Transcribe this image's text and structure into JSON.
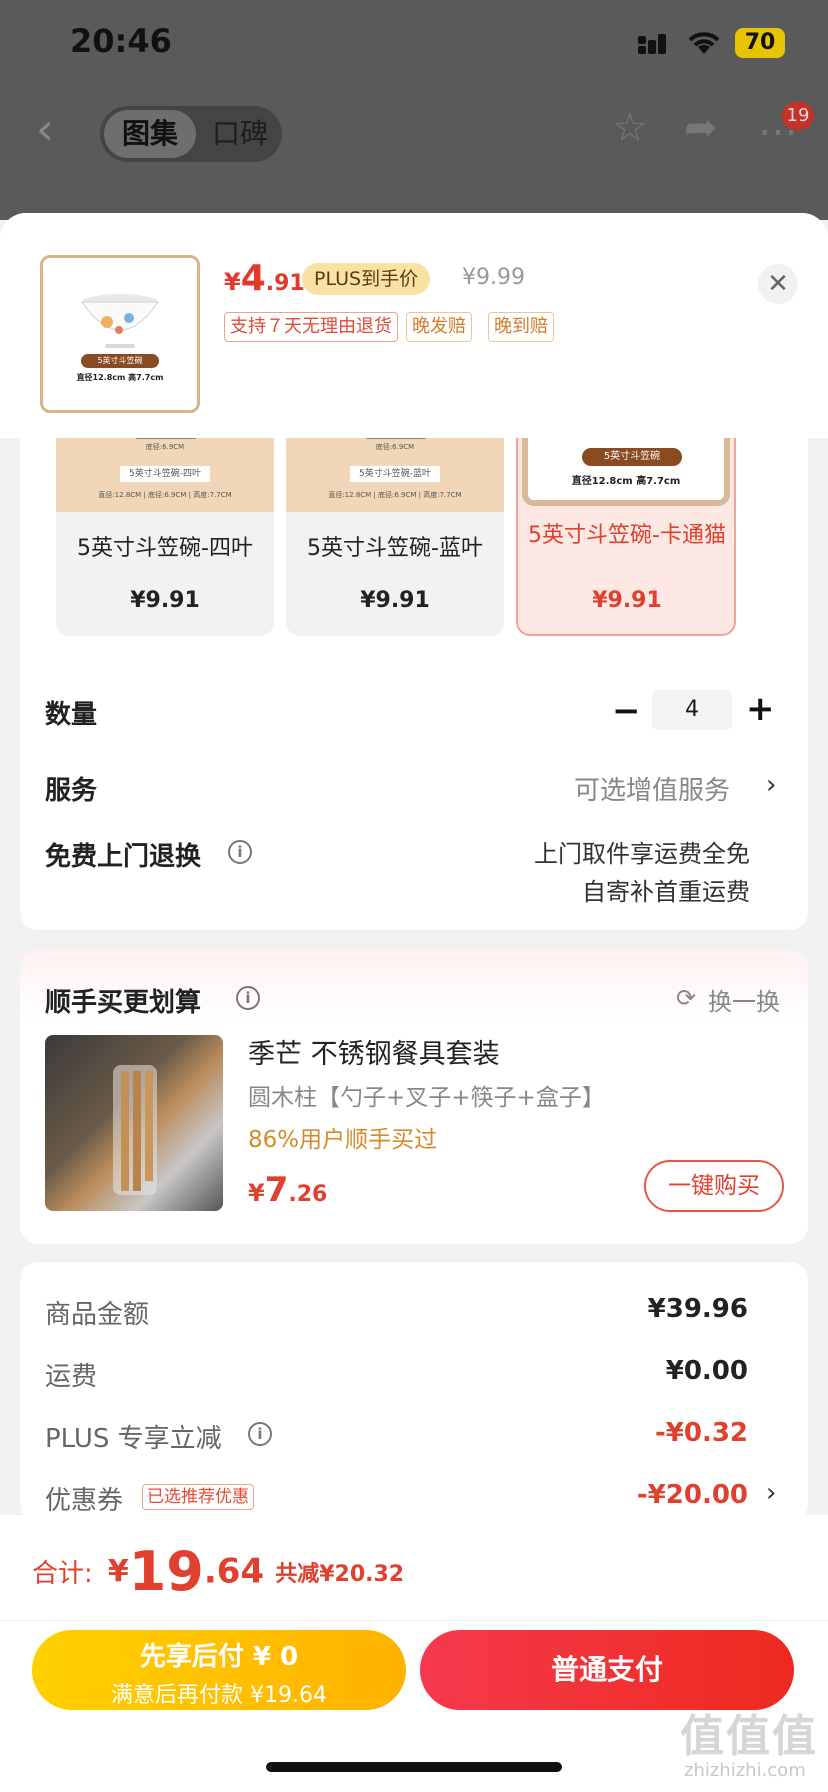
{
  "status_bar": {
    "time": "20:46",
    "battery": "70"
  },
  "nav": {
    "tab_gallery": "图集",
    "tab_reviews": "口碑",
    "badge": "19"
  },
  "header": {
    "price_symbol": "¥",
    "price_int": "4",
    "price_dec": ".91",
    "plus_label": "PLUS到手价",
    "original_price": "¥9.99",
    "tags": [
      "支持７天无理由退货",
      "晚发赔",
      "晚到赔"
    ],
    "thumb_label": "5英寸斗笠碗",
    "thumb_dims": "直径12.8cm  高7.7cm"
  },
  "options": [
    {
      "name": "5英寸斗笠碗-四叶",
      "price": "¥9.91",
      "img_label": "5英寸斗笠碗-四叶",
      "img_dims": "直径:12.8CM | 底径:6.9CM | 高度:7.7CM",
      "img_top": "底径:6.9CM"
    },
    {
      "name": "5英寸斗笠碗-蓝叶",
      "price": "¥9.91",
      "img_label": "5英寸斗笠碗-蓝叶",
      "img_dims": "直径:12.8CM | 底径:6.9CM | 高度:7.7CM",
      "img_top": "底径:6.9CM"
    },
    {
      "name": "5英寸斗笠碗-卡通猫",
      "price": "¥9.91",
      "img_label": "5英寸斗笠碗",
      "img_dims": "直径12.8cm  高7.7cm"
    }
  ],
  "quantity": {
    "label": "数量",
    "value": "4",
    "minus": "−",
    "plus": "+"
  },
  "service": {
    "label": "服务",
    "value": "可选增值服务"
  },
  "free_return": {
    "label": "免费上门退换",
    "line1": "上门取件享运费全免",
    "line2": "自寄补首重运费"
  },
  "recommend": {
    "title": "顺手买更划算",
    "refresh": "换一换",
    "product_name": "季芒 不锈钢餐具套装",
    "product_desc": "圆木柱【勺子+叉子+筷子+盒子】",
    "stat": "86%用户顺手买过",
    "price_symbol": "¥",
    "price_int": "7",
    "price_dec": ".26",
    "buy_label": "一键购买"
  },
  "summary": {
    "goods_label": "商品金额",
    "goods_value": "¥39.96",
    "shipping_label": "运费",
    "shipping_value": "¥0.00",
    "plus_label": "PLUS 专享立减",
    "plus_value": "-¥0.32",
    "coupon_label": "优惠券",
    "coupon_tag": "已选推荐优惠",
    "coupon_value": "-¥20.00"
  },
  "total": {
    "label": "合计:",
    "symbol": "¥",
    "int": "19",
    "dec": ".64",
    "saved": "共减¥20.32"
  },
  "buttons": {
    "pay_later_line1": "先享后付 ¥ 0",
    "pay_later_line2": "满意后再付款 ¥19.64",
    "pay_normal": "普通支付"
  },
  "watermark": {
    "text": "值值值",
    "url": "zhizhizhi.com"
  }
}
